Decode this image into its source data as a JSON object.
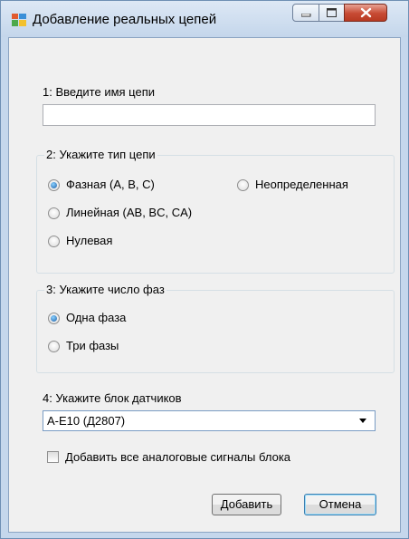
{
  "window": {
    "title": "Добавление реальных цепей",
    "caption_buttons": [
      "minimize-icon",
      "maximize-icon",
      "close-icon"
    ]
  },
  "name_section": {
    "label": "1: Введите имя цепи",
    "input_value": ""
  },
  "circuit_type": {
    "title": "2: Укажите тип цепи",
    "options": [
      {
        "label": "Фазная (A, B, C)",
        "checked": true
      },
      {
        "label": "Неопределенная",
        "checked": false
      },
      {
        "label": "Линейная (AB, BC, CA)",
        "checked": false
      },
      {
        "label": "Нулевая",
        "checked": false
      }
    ]
  },
  "phase_count": {
    "title": "3: Укажите число фаз",
    "options": [
      {
        "label": "Одна фаза",
        "checked": true
      },
      {
        "label": "Три фазы",
        "checked": false
      }
    ]
  },
  "sensor_block": {
    "label": "4: Укажите блок датчиков",
    "selected": "A-E10 (Д2807)"
  },
  "add_all_signals": {
    "label": "Добавить все аналоговые сигналы блока",
    "checked": false
  },
  "buttons": {
    "add": "Добавить",
    "cancel": "Отмена"
  },
  "colors": {
    "frame": "#c5d7ec",
    "client": "#f0f0f0",
    "close_button": "#c74a33",
    "radio_checked": "#1d5fa7",
    "default_button_border": "#3c7fb1"
  }
}
